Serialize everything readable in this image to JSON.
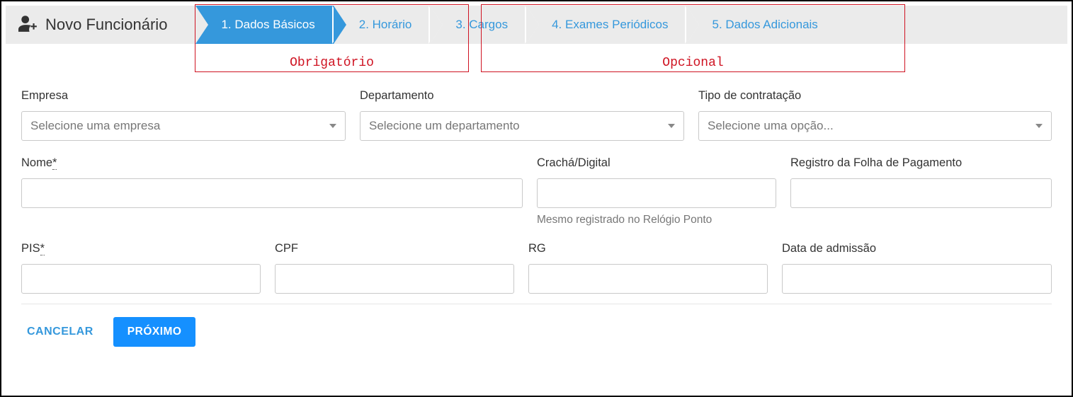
{
  "header": {
    "title": "Novo Funcionário"
  },
  "steps": {
    "s1": "1. Dados Básicos",
    "s2": "2. Horário",
    "s3": "3. Cargos",
    "s4": "4. Exames Periódicos",
    "s5": "5. Dados Adicionais"
  },
  "annotations": {
    "obrigatorio": "Obrigatório",
    "opcional": "Opcional"
  },
  "fields": {
    "empresa": {
      "label": "Empresa",
      "placeholder": "Selecione uma empresa"
    },
    "departamento": {
      "label": "Departamento",
      "placeholder": "Selecione um departamento"
    },
    "tipoContrato": {
      "label": "Tipo de contratação",
      "placeholder": "Selecione uma opção..."
    },
    "nome": {
      "label": "Nome",
      "star": "*"
    },
    "cracha": {
      "label": "Crachá/Digital",
      "hint": "Mesmo registrado no Relógio Ponto"
    },
    "regFolha": {
      "label": "Registro da Folha de Pagamento"
    },
    "pis": {
      "label": "PIS",
      "star": "*"
    },
    "cpf": {
      "label": "CPF"
    },
    "rg": {
      "label": "RG"
    },
    "dataAdmissao": {
      "label": "Data de admissão"
    }
  },
  "actions": {
    "cancelar": "CANCELAR",
    "proximo": "PRÓXIMO"
  }
}
